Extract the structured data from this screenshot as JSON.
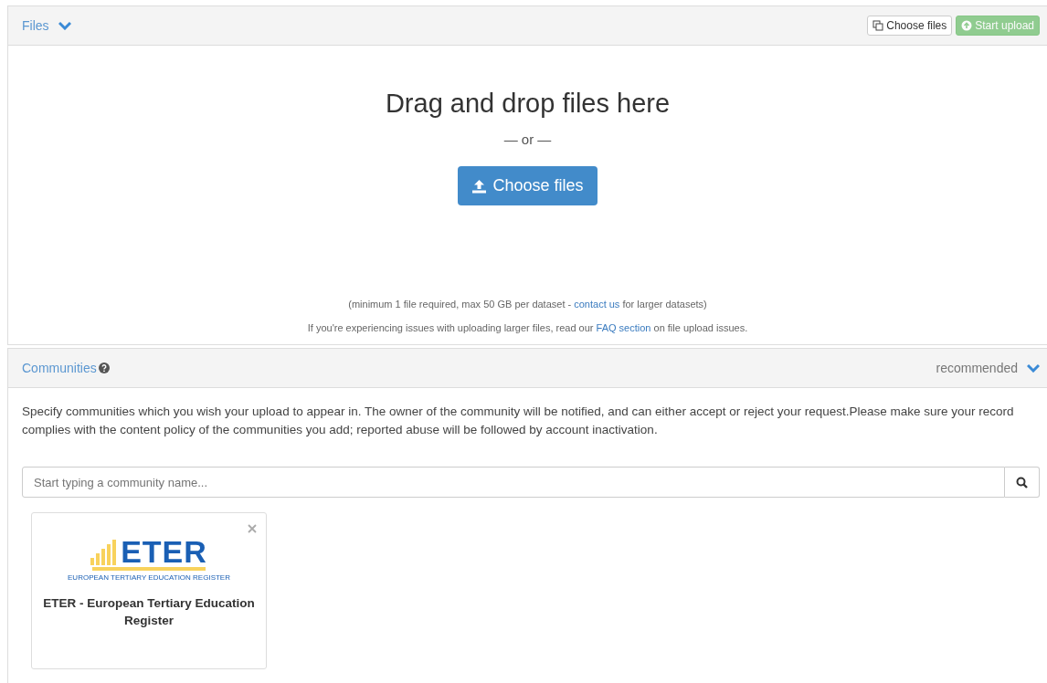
{
  "files_panel": {
    "title": "Files",
    "expanded": true,
    "header_buttons": [
      {
        "kind": "choose",
        "label": "Choose files",
        "disabled": false
      },
      {
        "kind": "upload",
        "label": "Start upload",
        "disabled": true
      }
    ],
    "drop_title": "Drag and drop files here",
    "separator": "— or —",
    "choose_button": "Choose files",
    "limit_note": {
      "before": "(minimum 1 file required, max 50 GB per dataset - ",
      "link": "contact us",
      "after": " for larger datasets)"
    },
    "issues_note": {
      "before": "If you're experiencing issues with uploading larger files, read our ",
      "link": "FAQ section",
      "after": " on file upload issues."
    }
  },
  "communities_panel": {
    "title": "Communities",
    "status": "recommended",
    "expanded": true,
    "description": "Specify communities which you wish your upload to appear in. The owner of the community will be notified, and can either accept or reject your request.Please make sure your record complies with the content policy of the communities you add; reported abuse will be followed by account inactivation.",
    "search": {
      "placeholder": "Start typing a community name..."
    },
    "communities": [
      {
        "logo_text": "ETER",
        "logo_tagline": "EUROPEAN TERTIARY EDUCATION REGISTER",
        "name": "ETER - European Tertiary Education Register"
      }
    ]
  }
}
